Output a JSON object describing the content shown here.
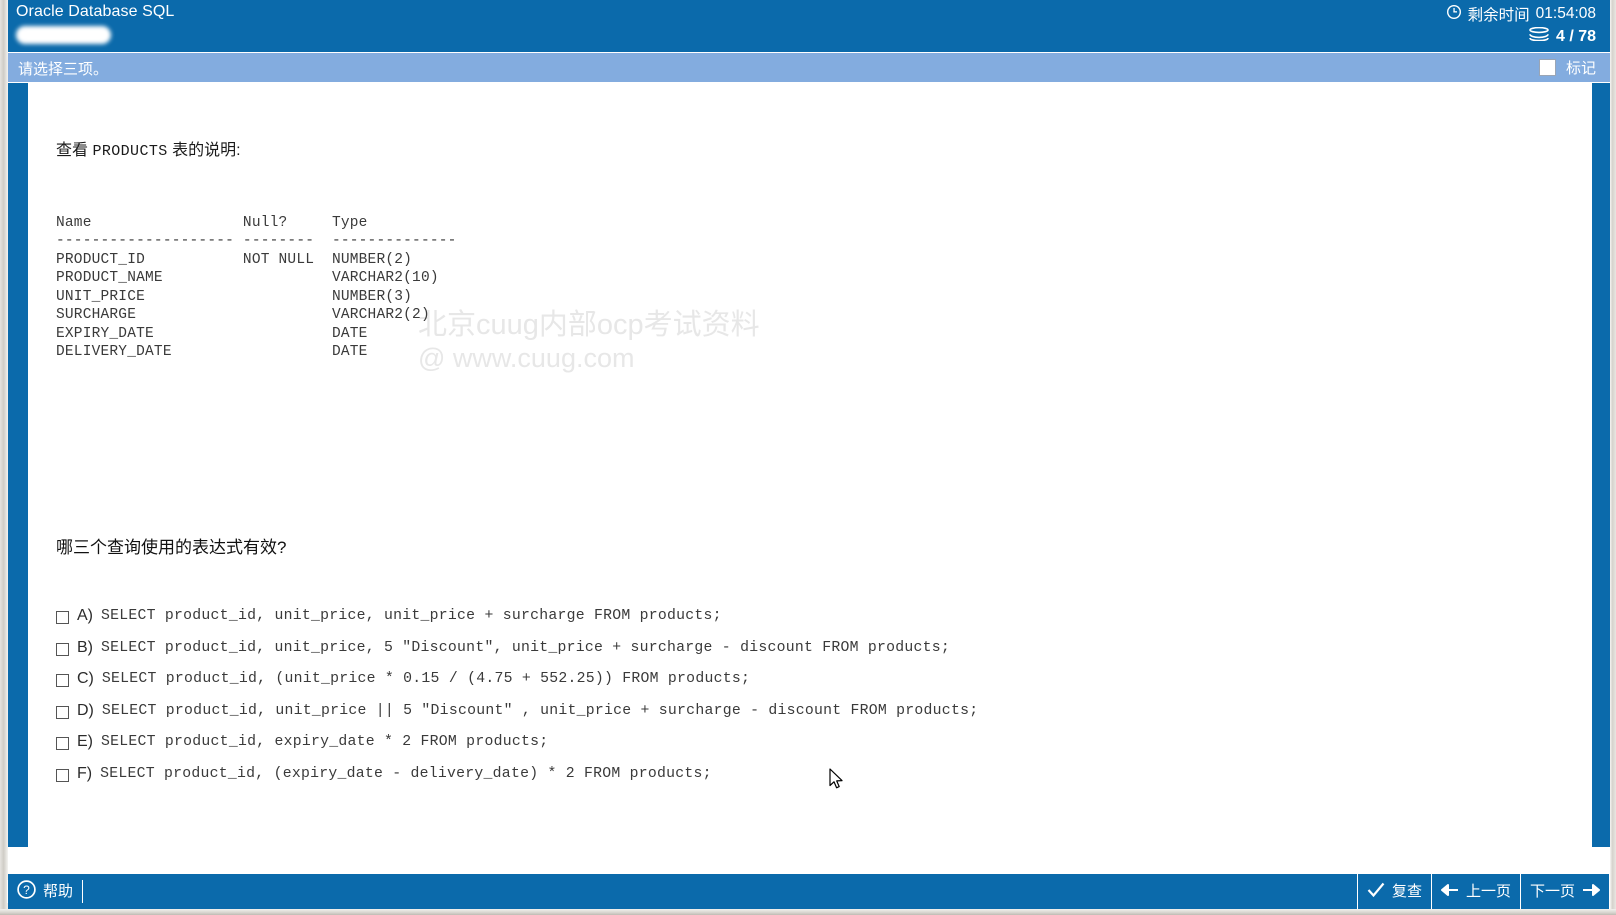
{
  "window": {
    "title": "Oracle Database SQL",
    "redaction_present": true
  },
  "header": {
    "clock_icon": "clock-icon",
    "time_label": "剩余时间",
    "time_value": "01:54:08",
    "stack_icon": "stacked-pages-icon",
    "question_progress": "4 / 78"
  },
  "instruction": {
    "text": "请选择三项。",
    "mark_label": "标记",
    "mark_checked": false
  },
  "body": {
    "stem_prefix": "查看 ",
    "stem_table": "PRODUCTS",
    "stem_suffix": " 表的说明:",
    "table_description": "Name                 Null?     Type\n-------------------- --------  --------------\nPRODUCT_ID           NOT NULL  NUMBER(2)\nPRODUCT_NAME                   VARCHAR2(10)\nUNIT_PRICE                     NUMBER(3)\nSURCHARGE                      VARCHAR2(2)\nEXPIRY_DATE                    DATE\nDELIVERY_DATE                  DATE",
    "question": "哪三个查询使用的表达式有效?",
    "options": [
      {
        "letter": "A)",
        "text": "SELECT product_id, unit_price, unit_price + surcharge FROM products;",
        "checked": false
      },
      {
        "letter": "B)",
        "text": "SELECT product_id, unit_price, 5 \"Discount\", unit_price + surcharge - discount FROM products;",
        "checked": false
      },
      {
        "letter": "C)",
        "text": "SELECT product_id, (unit_price * 0.15 / (4.75 + 552.25)) FROM products;",
        "checked": false
      },
      {
        "letter": "D)",
        "text": "SELECT product_id, unit_price || 5 \"Discount\" , unit_price + surcharge - discount FROM products;",
        "checked": false
      },
      {
        "letter": "E)",
        "text": "SELECT product_id, expiry_date * 2 FROM products;",
        "checked": false
      },
      {
        "letter": "F)",
        "text": "SELECT product_id, (expiry_date - delivery_date) * 2 FROM products;",
        "checked": false
      }
    ]
  },
  "watermark": {
    "line1": "北京cuug内部ocp考试资料",
    "line2": "@ www.cuug.com"
  },
  "footer": {
    "help_label": "帮助",
    "review_label": "复查",
    "prev_label": "上一页",
    "next_label": "下一页"
  },
  "colors": {
    "header_blue": "#0b6aab",
    "instruction_blue": "#83acdf",
    "text_dark": "#3a3a3a",
    "white": "#ffffff",
    "watermark_gray": "#e7e7e7"
  }
}
